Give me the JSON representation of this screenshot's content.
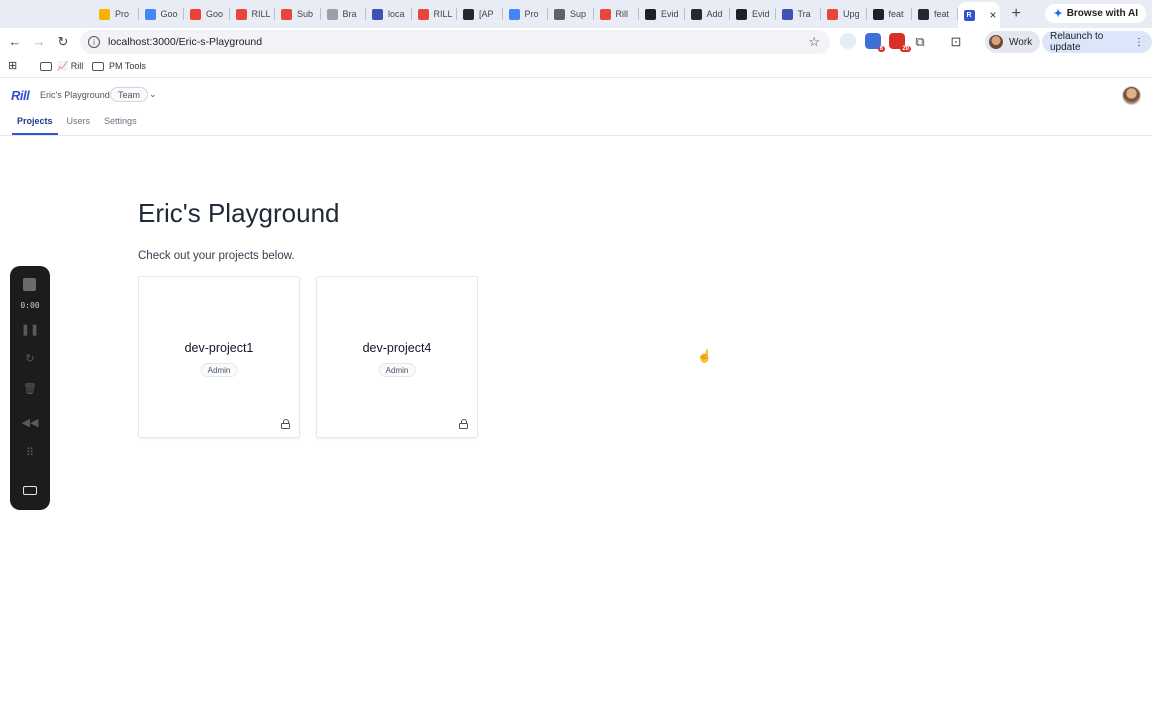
{
  "browser": {
    "tabs": [
      {
        "label": "Pro",
        "color": "#f4b400"
      },
      {
        "label": "Goo",
        "color": "#4285f4"
      },
      {
        "label": "Goo",
        "color": "#ea4335"
      },
      {
        "label": "RILL",
        "color": "#e8453c"
      },
      {
        "label": "Sub",
        "color": "#e8453c"
      },
      {
        "label": "Bra",
        "color": "#9aa0a6"
      },
      {
        "label": "loca",
        "color": "#3f51b5"
      },
      {
        "label": "RILL",
        "color": "#e8453c"
      },
      {
        "label": "[AP",
        "color": "#24292f"
      },
      {
        "label": "Pro",
        "color": "#4285f4"
      },
      {
        "label": "Sup",
        "color": "#5f6368"
      },
      {
        "label": "Rill",
        "color": "#e8453c"
      },
      {
        "label": "Evid",
        "color": "#202124"
      },
      {
        "label": "Add",
        "color": "#24292f"
      },
      {
        "label": "Evid",
        "color": "#202124"
      },
      {
        "label": "Tra",
        "color": "#3f51b5"
      },
      {
        "label": "Upg",
        "color": "#e8453c"
      },
      {
        "label": "feat",
        "color": "#202124"
      },
      {
        "label": "feat",
        "color": "#24292f"
      }
    ],
    "active_tab_icon": "rill-favicon",
    "new_tab": "+",
    "close": "×",
    "browse_ai": "Browse with AI",
    "url": "localhost:3000/Eric-s-Playground",
    "profile": "Work",
    "relaunch": "Relaunch to update",
    "badges": {
      "ext1": "6",
      "ext2": "20"
    },
    "bookmarks": [
      {
        "label": "📈 Rill",
        "icon": "folder-icon"
      },
      {
        "label": "PM Tools",
        "icon": "folder-icon"
      }
    ]
  },
  "app": {
    "logo": "Rill",
    "org_name": "Eric's Playground",
    "org_badge": "Team",
    "nav": {
      "projects": "Projects",
      "users": "Users",
      "settings": "Settings"
    },
    "title": "Eric's Playground",
    "subtitle": "Check out your projects below.",
    "projects": [
      {
        "name": "dev-project1",
        "role": "Admin"
      },
      {
        "name": "dev-project4",
        "role": "Admin"
      }
    ]
  },
  "recorder": {
    "time": "0:00"
  },
  "colors": {
    "accent": "#3451d1",
    "active_nav": "#1e3a8a"
  }
}
